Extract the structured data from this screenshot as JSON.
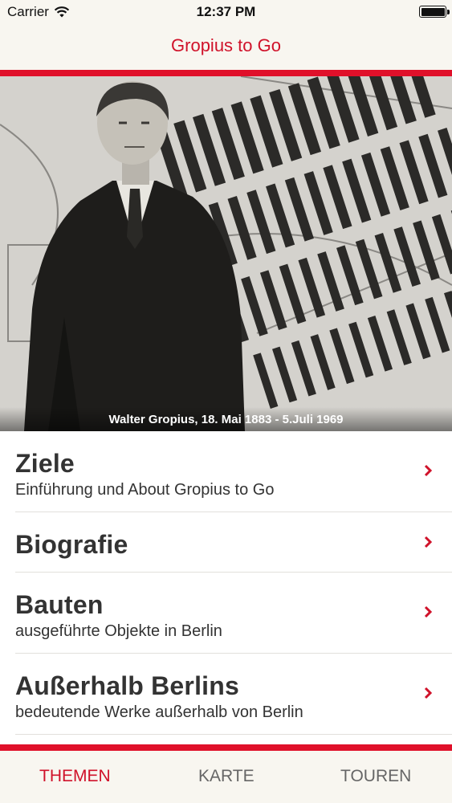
{
  "status_bar": {
    "carrier": "Carrier",
    "time": "12:37 PM"
  },
  "nav": {
    "title": "Gropius to Go"
  },
  "hero": {
    "caption": "Walter Gropius, 18. Mai 1883 - 5.Juli 1969"
  },
  "menu": {
    "items": [
      {
        "title": "Ziele",
        "subtitle": "Einführung und About Gropius to Go"
      },
      {
        "title": "Biografie",
        "subtitle": ""
      },
      {
        "title": "Bauten",
        "subtitle": "ausgeführte Objekte in Berlin"
      },
      {
        "title": "Außerhalb Berlins",
        "subtitle": "bedeutende Werke außerhalb von Berlin"
      }
    ]
  },
  "tabs": [
    {
      "label": "THEMEN",
      "active": true
    },
    {
      "label": "KARTE",
      "active": false
    },
    {
      "label": "TOUREN",
      "active": false
    }
  ],
  "colors": {
    "accent": "#e0102a",
    "accent_text": "#d0122a",
    "background": "#f8f6f0"
  }
}
